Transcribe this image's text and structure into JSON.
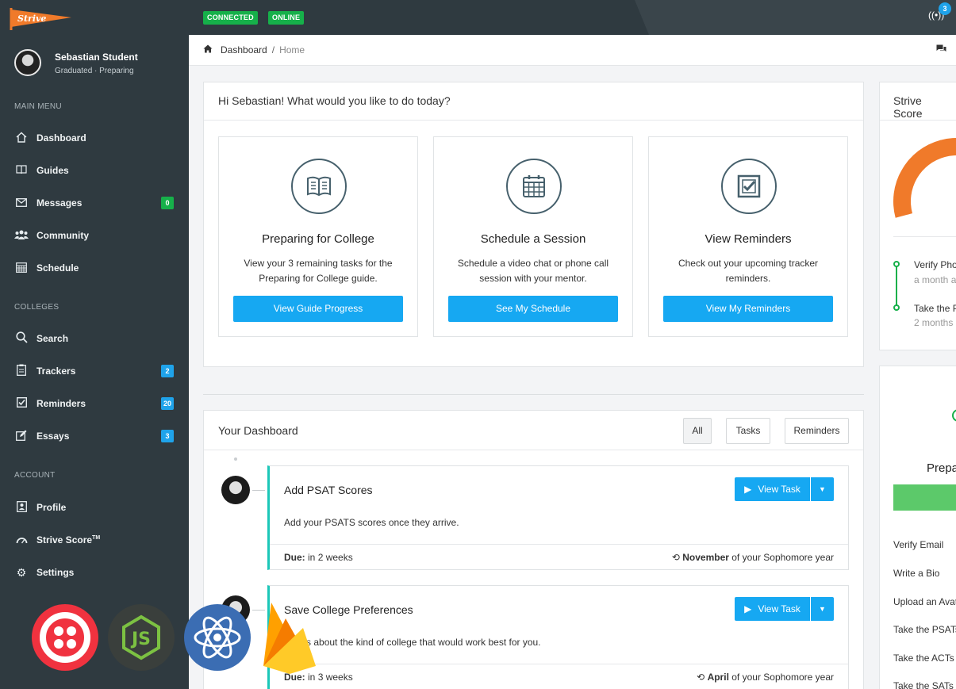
{
  "topbar": {
    "logo_text": "Strive",
    "status_connected": "CONNECTED",
    "status_online": "ONLINE",
    "notification_count": "3"
  },
  "user": {
    "name": "Sebastian Student",
    "status": "Graduated · Preparing"
  },
  "sidebar": {
    "main_menu_label": "MAIN MENU",
    "main_items": [
      {
        "label": "Dashboard",
        "icon": "home-icon"
      },
      {
        "label": "Guides",
        "icon": "book-icon"
      },
      {
        "label": "Messages",
        "icon": "envelope-icon",
        "badge": "0"
      },
      {
        "label": "Community",
        "icon": "users-icon"
      },
      {
        "label": "Schedule",
        "icon": "calendar-icon"
      }
    ],
    "colleges_label": "COLLEGES",
    "college_items": [
      {
        "label": "Search",
        "icon": "search-icon"
      },
      {
        "label": "Trackers",
        "icon": "clipboard-icon",
        "badge": "2"
      },
      {
        "label": "Reminders",
        "icon": "checkbox-icon",
        "badge": "20"
      },
      {
        "label": "Essays",
        "icon": "edit-icon",
        "badge": "3"
      }
    ],
    "account_label": "ACCOUNT",
    "account_items": [
      {
        "label": "Profile",
        "icon": "profile-icon"
      },
      {
        "label": "Strive Score",
        "sup": "TM",
        "icon": "gauge-icon"
      },
      {
        "label": "Settings",
        "icon": "gear-icon"
      }
    ],
    "badge_colors": {
      "green": "#16b04a",
      "blue": "#1fa3ea"
    }
  },
  "breadcrumb": {
    "root": "Dashboard",
    "separator": "/",
    "current": "Home"
  },
  "welcome": {
    "greeting_name": "Hi Sebastian!",
    "greeting_rest": "What would you like to do today?",
    "cards": [
      {
        "title": "Preparing for College",
        "text": "View your 3 remaining tasks for the Preparing for College guide.",
        "button": "View Guide Progress",
        "icon": "open-book-icon"
      },
      {
        "title": "Schedule a Session",
        "text": "Schedule a video chat or phone call session with your mentor.",
        "button": "See My Schedule",
        "icon": "calendar-icon"
      },
      {
        "title": "View Reminders",
        "text": "Check out your upcoming tracker reminders.",
        "button": "View My Reminders",
        "icon": "checkbox-icon"
      }
    ]
  },
  "dashboard": {
    "title": "Your Dashboard",
    "filters": [
      "All",
      "Tasks",
      "Reminders"
    ],
    "tasks": [
      {
        "title": "Add PSAT Scores",
        "description": "Add your PSATS scores once they arrive.",
        "due_label": "Due:",
        "due_value": "in 2 weeks",
        "when_bold": "November",
        "when_rest": "of your Sophomore year",
        "button": "View Task"
      },
      {
        "title": "Save College Preferences",
        "description": "Tell us about the kind of college that would work best for you.",
        "due_label": "Due:",
        "due_value": "in 3 weeks",
        "when_bold": "April",
        "when_rest": "of your Sophomore year",
        "button": "View Task"
      }
    ]
  },
  "right_panel": {
    "score_title": "Strive Score",
    "timeline": [
      {
        "title": "Verify Pho",
        "sub": "a month a"
      },
      {
        "title": "Take the P",
        "sub": "2 months"
      }
    ],
    "progress_title": "Prepa",
    "checklist": [
      "Verify Email",
      "Write a Bio",
      "Upload an Avat",
      "Take the PSATs",
      "Take the ACTs",
      "Take the SATs"
    ],
    "accent_color": "#f07a2a",
    "green": "#16b04a"
  },
  "tech_logos": [
    "twilio-logo",
    "nodejs-logo",
    "react-logo",
    "firebase-logo"
  ]
}
